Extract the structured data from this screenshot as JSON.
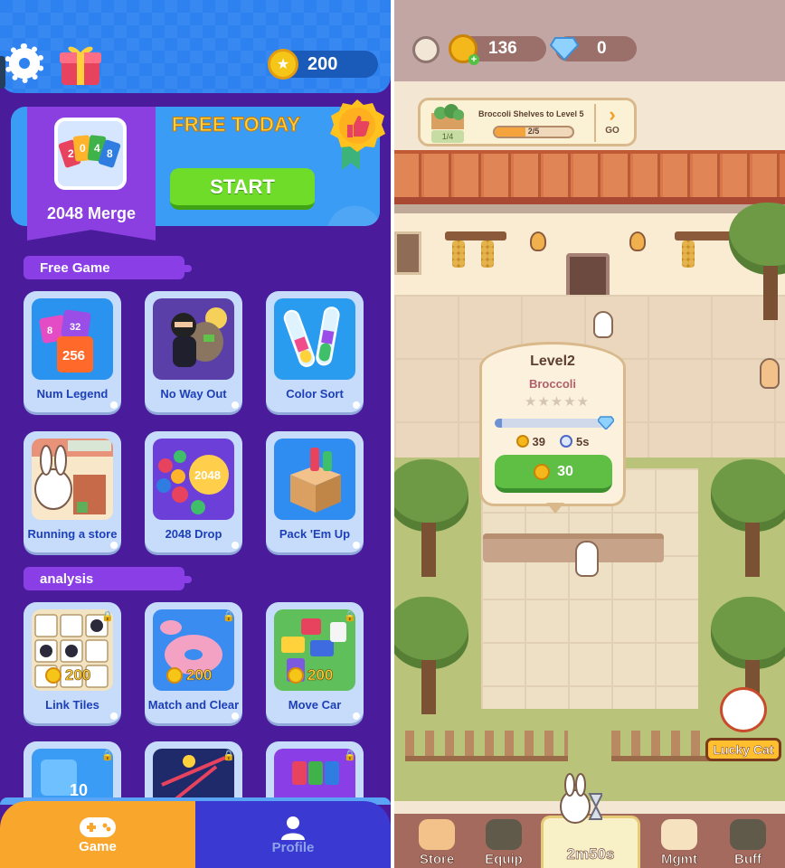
{
  "left_app": {
    "coins": "200",
    "featured": {
      "game_name": "2048 Merge",
      "promo_text": "FREE TODAY",
      "start_label": "START",
      "icon_digits": [
        "2",
        "0",
        "4",
        "8"
      ]
    },
    "sections": [
      {
        "title": "Free Game",
        "games": [
          {
            "label": "Num Legend",
            "icon": "number-blocks-icon"
          },
          {
            "label": "No Way Out",
            "icon": "thief-icon"
          },
          {
            "label": "Color Sort",
            "icon": "test-tubes-icon"
          },
          {
            "label": "Running a store",
            "icon": "rabbit-store-icon"
          },
          {
            "label": "2048 Drop",
            "icon": "balls-2048-icon"
          },
          {
            "label": "Pack 'Em Up",
            "icon": "box-icon"
          }
        ]
      },
      {
        "title": "analysis",
        "games": [
          {
            "label": "Link Tiles",
            "price": "200",
            "locked": true
          },
          {
            "label": "Match and Clear",
            "price": "200",
            "locked": true
          },
          {
            "label": "Move Car",
            "price": "200",
            "locked": true
          }
        ]
      }
    ],
    "nav": {
      "game_label": "Game",
      "profile_label": "Profile"
    },
    "partial_tiles": {
      "label_digits": "10"
    }
  },
  "right_app": {
    "paw_coins": "136",
    "gems": "0",
    "quest": {
      "title": "Broccoli Shelves to Level 5",
      "fraction": "1/4",
      "progress_label": "2/5",
      "progress": 0.4,
      "go_label": "GO"
    },
    "popup": {
      "level": "Level2",
      "item": "Broccoli",
      "stars": "★★★★★",
      "coins_per": "39",
      "time": "5s",
      "upgrade_cost": "30",
      "progress": 0.06
    },
    "lucky_cat_label": "Lucky Cat",
    "nav": [
      {
        "label": "Store"
      },
      {
        "label": "Equip"
      },
      {
        "label": "2m50s"
      },
      {
        "label": "Mgmt"
      },
      {
        "label": "Buff"
      }
    ]
  }
}
